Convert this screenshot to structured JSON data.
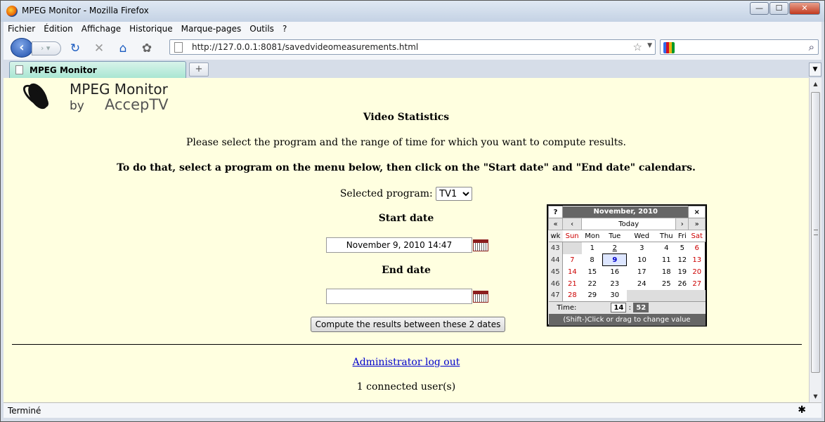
{
  "window": {
    "title": "MPEG Monitor - Mozilla Firefox",
    "min": "—",
    "max": "☐",
    "close": "✕"
  },
  "menu": [
    "Fichier",
    "Édition",
    "Affichage",
    "Historique",
    "Marque-pages",
    "Outils",
    "?"
  ],
  "nav": {
    "url": "http://127.0.0.1:8081/savedvideomeasurements.html"
  },
  "tab": {
    "label": "MPEG Monitor",
    "new": "+"
  },
  "logo": {
    "line1": "MPEG Monitor",
    "by": "by",
    "brand": "AccepTV"
  },
  "page": {
    "heading": "Video Statistics",
    "intro": "Please select the program and the range of time for which you want to compute results.",
    "instruction": "To do that, select a program on the menu below, then click on the \"Start date\" and \"End date\" calendars.",
    "program_label": "Selected program:",
    "program_value": "TV1",
    "start_label": "Start date",
    "start_value": "November 9, 2010 14:47",
    "end_label": "End date",
    "end_value": "",
    "compute_label": "Compute the results between these 2 dates",
    "logout": "Administrator log out",
    "users": "1 connected user(s)"
  },
  "calendar": {
    "help": "?",
    "title": "November, 2010",
    "close": "×",
    "prev_year": "«",
    "prev_month": "‹",
    "today": "Today",
    "next_month": "›",
    "next_year": "»",
    "wk": "wk",
    "days": [
      "Sun",
      "Mon",
      "Tue",
      "Wed",
      "Thu",
      "Fri",
      "Sat"
    ],
    "weeks": [
      {
        "wk": "43",
        "d": [
          "",
          "1",
          "2",
          "3",
          "4",
          "5",
          "6"
        ]
      },
      {
        "wk": "44",
        "d": [
          "7",
          "8",
          "9",
          "10",
          "11",
          "12",
          "13"
        ]
      },
      {
        "wk": "45",
        "d": [
          "14",
          "15",
          "16",
          "17",
          "18",
          "19",
          "20"
        ]
      },
      {
        "wk": "46",
        "d": [
          "21",
          "22",
          "23",
          "24",
          "25",
          "26",
          "27"
        ]
      },
      {
        "wk": "47",
        "d": [
          "28",
          "29",
          "30",
          "",
          "",
          "",
          ""
        ]
      }
    ],
    "selected_day": "9",
    "time_label": "Time:",
    "hour": "14",
    "sep": ":",
    "minute": "52",
    "footer": "(Shift-)Click or drag to change value"
  },
  "status": {
    "text": "Terminé"
  }
}
